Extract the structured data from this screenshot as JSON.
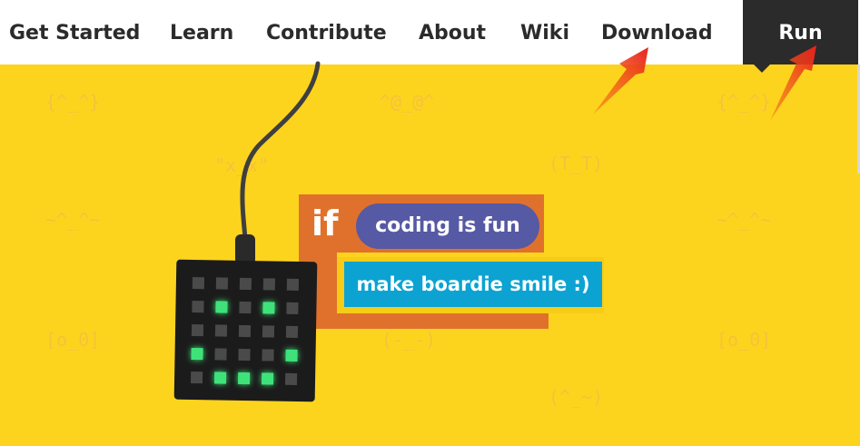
{
  "nav": {
    "items": [
      "Get Started",
      "Learn",
      "Contribute",
      "About",
      "Wiki",
      "Download"
    ],
    "run_label": "Run"
  },
  "hero": {
    "emoticons": [
      "{^_^}",
      "^@_@^",
      "{^_^}",
      "\"x_x\"",
      "(T_T)",
      "~^_^~",
      "~^_^~",
      "[o_0]",
      "(-_-)",
      "[o_0]",
      "(^_~)"
    ],
    "block_if": "if",
    "condition": "coding is fun",
    "action": "make boardie smile :)"
  },
  "board": {
    "grid_size": 5,
    "lit_cells": [
      [
        1,
        1
      ],
      [
        1,
        3
      ],
      [
        3,
        0
      ],
      [
        3,
        4
      ],
      [
        4,
        1
      ],
      [
        4,
        2
      ],
      [
        4,
        3
      ]
    ]
  },
  "colors": {
    "background": "#fdd41d",
    "nav_bg": "#ffffff",
    "run_bg": "#2b2b2b",
    "if_block": "#e0712c",
    "condition_block": "#5659a4",
    "action_block": "#0ca3d2",
    "led_on": "#3fe27a",
    "led_off": "#4a4a4a",
    "annotation_arrow": "#e8231c"
  }
}
